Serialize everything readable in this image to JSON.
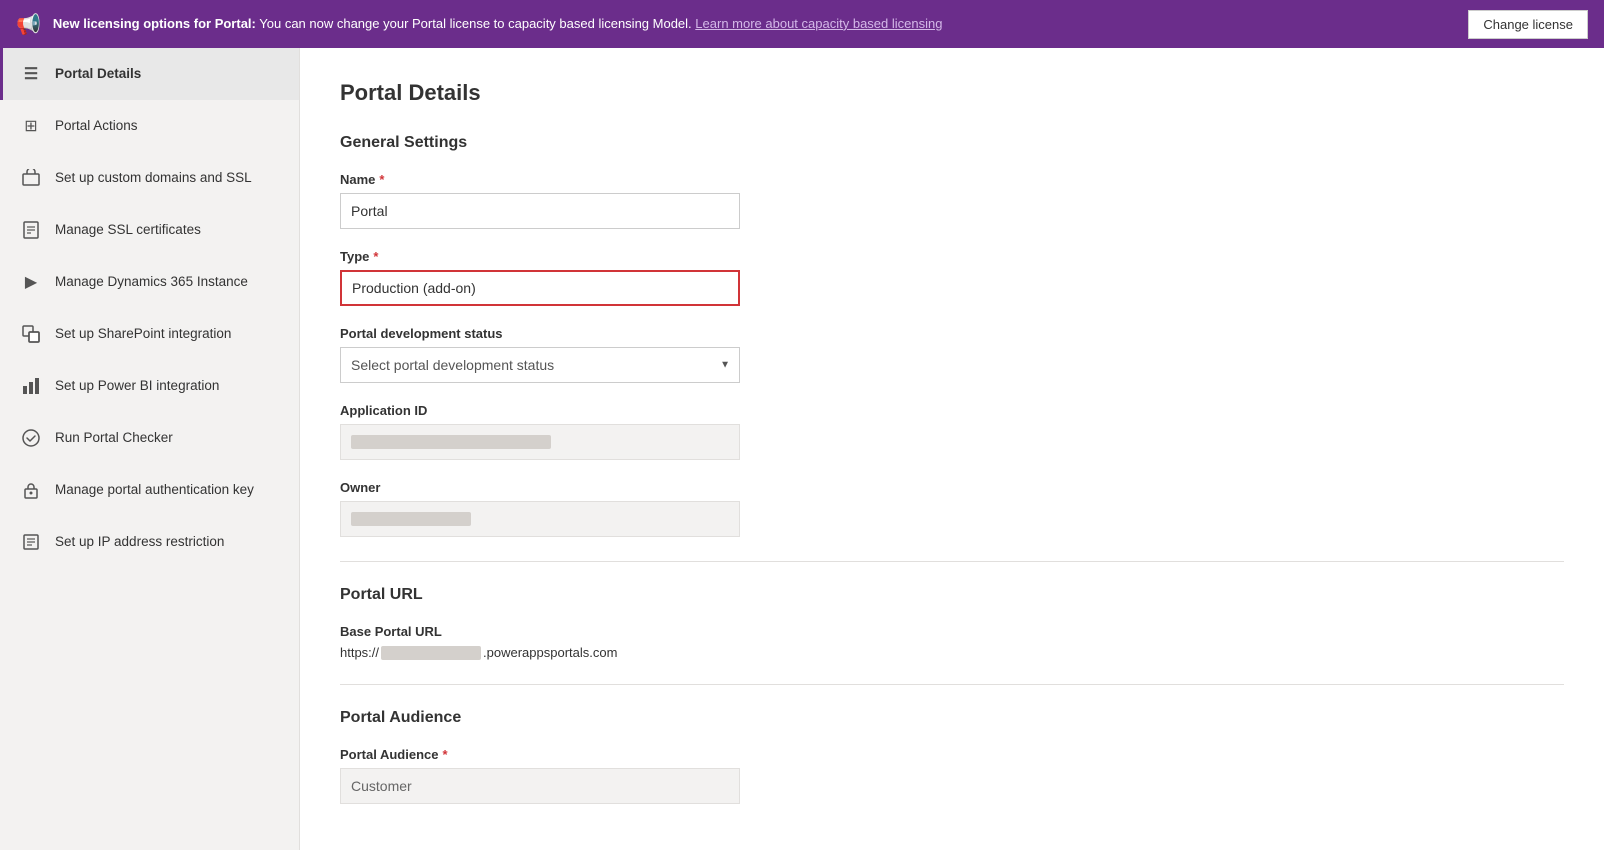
{
  "banner": {
    "icon": "📢",
    "text_bold": "New licensing options for Portal:",
    "text_normal": " You can now change your Portal license to capacity based licensing Model.",
    "link_text": "Learn more about capacity based licensing",
    "button_label": "Change license"
  },
  "sidebar": {
    "items": [
      {
        "id": "portal-details",
        "label": "Portal Details",
        "icon": "☰",
        "active": true
      },
      {
        "id": "portal-actions",
        "label": "Portal Actions",
        "icon": "⊞"
      },
      {
        "id": "custom-domains",
        "label": "Set up custom domains and SSL",
        "icon": "⊡"
      },
      {
        "id": "ssl-certs",
        "label": "Manage SSL certificates",
        "icon": "📄"
      },
      {
        "id": "dynamics-instance",
        "label": "Manage Dynamics 365 Instance",
        "icon": "▶"
      },
      {
        "id": "sharepoint",
        "label": "Set up SharePoint integration",
        "icon": "S"
      },
      {
        "id": "power-bi",
        "label": "Set up Power BI integration",
        "icon": "📊"
      },
      {
        "id": "portal-checker",
        "label": "Run Portal Checker",
        "icon": "✓"
      },
      {
        "id": "auth-key",
        "label": "Manage portal authentication key",
        "icon": "🔒"
      },
      {
        "id": "ip-restriction",
        "label": "Set up IP address restriction",
        "icon": "📋"
      }
    ]
  },
  "content": {
    "page_title": "Portal Details",
    "general_settings": {
      "section_title": "General Settings",
      "name_label": "Name",
      "name_required": true,
      "name_value": "Portal",
      "type_label": "Type",
      "type_required": true,
      "type_value": "Production (add-on)",
      "dev_status_label": "Portal development status",
      "dev_status_placeholder": "Select portal development status",
      "app_id_label": "Application ID",
      "owner_label": "Owner"
    },
    "portal_url": {
      "section_title": "Portal URL",
      "base_url_label": "Base Portal URL",
      "base_url_prefix": "https://",
      "base_url_suffix": ".powerappsportals.com"
    },
    "portal_audience": {
      "section_title": "Portal Audience",
      "audience_label": "Portal Audience",
      "audience_required": true,
      "audience_value": "Customer"
    }
  },
  "colors": {
    "accent": "#6b2d8b",
    "error": "#d13438",
    "border_highlight": "#d13438"
  }
}
